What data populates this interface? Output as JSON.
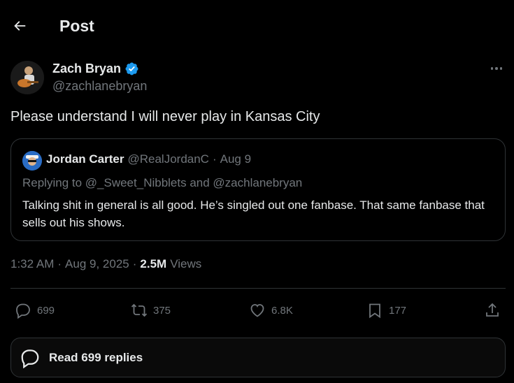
{
  "header": {
    "title": "Post",
    "back_icon": "arrow-left-icon"
  },
  "post": {
    "author_name": "Zach Bryan",
    "author_handle": "@zachlanebryan",
    "verified": true,
    "text": "Please understand I will never play in Kansas City",
    "more_icon": "more-horizontal-icon"
  },
  "quote": {
    "name": "Jordan Carter",
    "handle": "@RealJordanC",
    "separator": "·",
    "date": "Aug 9",
    "replying_to": "Replying to @_Sweet_Nibblets and @zachlanebryan",
    "text": "Talking shit in general is all good. He’s singled out one fanbase. That same fanbase that sells out his shows."
  },
  "meta": {
    "time": "1:32 AM",
    "sep1": "·",
    "date": "Aug 9, 2025",
    "sep2": "·",
    "views_count": "2.5M",
    "views_label": "Views"
  },
  "actions": {
    "replies": "699",
    "reposts": "375",
    "likes": "6.8K",
    "bookmarks": "177"
  },
  "read_replies": {
    "label": "Read 699 replies"
  },
  "colors": {
    "background": "#000000",
    "text": "#e7e9ea",
    "muted": "#71767b",
    "border": "#2f3336",
    "verified": "#1d9bf0"
  }
}
